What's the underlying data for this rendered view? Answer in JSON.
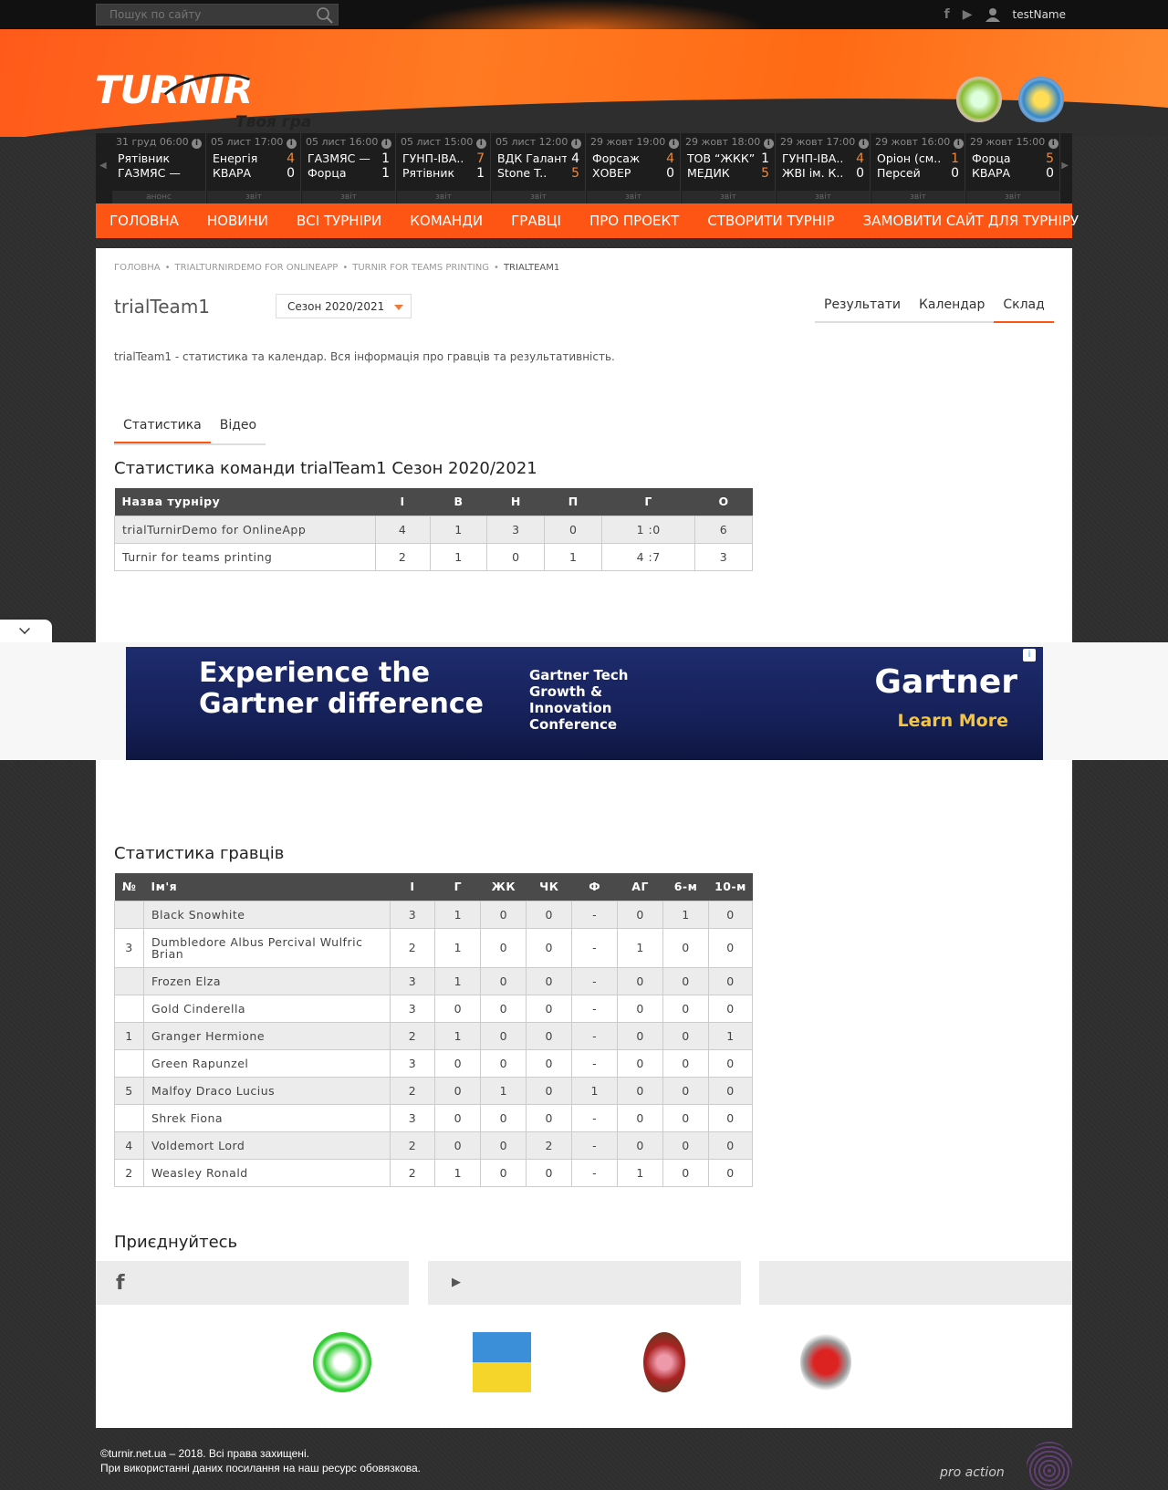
{
  "topbar": {
    "search_placeholder": "Пошук по сайту",
    "user_name": "testName"
  },
  "header": {
    "logo_text": "TURNIR",
    "slogan": "Твоя гра"
  },
  "matches": [
    {
      "date": "31 груд 06:00",
      "team1": "Рятівник",
      "score1": "",
      "team2": "ГАЗМЯС —",
      "score2": "",
      "status": "анонс"
    },
    {
      "date": "05 лист 17:00",
      "team1": "Енергія",
      "score1": "4",
      "team2": "КВАРА",
      "score2": "0",
      "status": "звіт"
    },
    {
      "date": "05 лист 16:00",
      "team1": "ГАЗМЯС —",
      "score1": "1",
      "team2": "Форца",
      "score2": "1",
      "status": "звіт"
    },
    {
      "date": "05 лист 15:00",
      "team1": "ГУНП-ІВА..",
      "score1": "7",
      "team2": "Рятівник",
      "score2": "1",
      "status": "звіт"
    },
    {
      "date": "05 лист 12:00",
      "team1": "ВДК Галант",
      "score1": "4",
      "team2": "Stone T..",
      "score2": "5",
      "status": "звіт"
    },
    {
      "date": "29 жовт 19:00",
      "team1": "Форсаж",
      "score1": "4",
      "team2": "ХОВЕР",
      "score2": "0",
      "status": "звіт"
    },
    {
      "date": "29 жовт 18:00",
      "team1": "ТОВ “ЖКК”",
      "score1": "1",
      "team2": "МЕДИК",
      "score2": "5",
      "status": "звіт"
    },
    {
      "date": "29 жовт 17:00",
      "team1": "ГУНП-ІВА..",
      "score1": "4",
      "team2": "ЖВІ ім. К..",
      "score2": "0",
      "status": "звіт"
    },
    {
      "date": "29 жовт 16:00",
      "team1": "Оріон (см..",
      "score1": "1",
      "team2": "Персей",
      "score2": "0",
      "status": "звіт"
    },
    {
      "date": "29 жовт 15:00",
      "team1": "Форца",
      "score1": "5",
      "team2": "КВАРА",
      "score2": "0",
      "status": "звіт"
    }
  ],
  "nav": [
    "ГОЛОВНА",
    "НОВИНИ",
    "ВСІ ТУРНІРИ",
    "КОМАНДИ",
    "ГРАВЦІ",
    "ПРО ПРОЕКТ",
    "СТВОРИТИ ТУРНІР",
    "ЗАМОВИТИ САЙТ ДЛЯ ТУРНІРУ"
  ],
  "breadcrumb": [
    "Головна",
    "trialTurnirDemo for OnlineApp",
    "Turnir for teams printing",
    "trialTeam1"
  ],
  "team": {
    "title": "trialTeam1",
    "season": "Сезон 2020/2021",
    "description": "trialTeam1 - статистика та календар. Вся інформація про гравців та результативність."
  },
  "right_tabs": [
    "Результати",
    "Календар",
    "Склад"
  ],
  "left_tabs": [
    "Статистика",
    "Відео"
  ],
  "team_stats": {
    "title": "Статистика команди trialTeam1 Сезон 2020/2021",
    "headers": [
      "Назва турніру",
      "І",
      "В",
      "Н",
      "П",
      "Г",
      "О"
    ],
    "rows": [
      [
        "trialTurnirDemo for OnlineApp",
        "4",
        "1",
        "3",
        "0",
        "1 :0",
        "6"
      ],
      [
        "Turnir for teams printing",
        "2",
        "1",
        "0",
        "1",
        "4 :7",
        "3"
      ]
    ]
  },
  "ad": {
    "headline1": "Experience the",
    "headline2": "Gartner difference",
    "mid1": "Gartner Tech",
    "mid2": "Growth &",
    "mid3": "Innovation",
    "mid4": "Conference",
    "brand": "Gartner",
    "cta": "Learn More"
  },
  "player_stats": {
    "title": "Статистика гравців",
    "headers": [
      "№",
      "Ім'я",
      "І",
      "Г",
      "ЖК",
      "ЧК",
      "Ф",
      "АГ",
      "6-м",
      "10-м"
    ],
    "rows": [
      [
        "",
        "Black Snowhite",
        "3",
        "1",
        "0",
        "0",
        "-",
        "0",
        "1",
        "0"
      ],
      [
        "3",
        "Dumbledore Albus Percival Wulfric Brian",
        "2",
        "1",
        "0",
        "0",
        "-",
        "1",
        "0",
        "0"
      ],
      [
        "",
        "Frozen Elza",
        "3",
        "1",
        "0",
        "0",
        "-",
        "0",
        "0",
        "0"
      ],
      [
        "",
        "Gold Cinderella",
        "3",
        "0",
        "0",
        "0",
        "-",
        "0",
        "0",
        "0"
      ],
      [
        "1",
        "Granger Hermione",
        "2",
        "1",
        "0",
        "0",
        "-",
        "0",
        "0",
        "1"
      ],
      [
        "",
        "Green Rapunzel",
        "3",
        "0",
        "0",
        "0",
        "-",
        "0",
        "0",
        "0"
      ],
      [
        "5",
        "Malfoy Draco Lucius",
        "2",
        "0",
        "1",
        "0",
        "1",
        "0",
        "0",
        "0"
      ],
      [
        "",
        "Shrek Fiona",
        "3",
        "0",
        "0",
        "0",
        "-",
        "0",
        "0",
        "0"
      ],
      [
        "4",
        "Voldemort Lord",
        "2",
        "0",
        "0",
        "2",
        "-",
        "0",
        "0",
        "0"
      ],
      [
        "2",
        "Weasley Ronald",
        "2",
        "1",
        "0",
        "0",
        "-",
        "1",
        "0",
        "0"
      ]
    ]
  },
  "join": {
    "title": "Приєднуйтесь"
  },
  "footer": {
    "line1": "©turnir.net.ua – 2018. Всі права захищені.",
    "line2": "При використанні даних посилання на наш ресурс обовязкова.",
    "brand": "pro action"
  }
}
